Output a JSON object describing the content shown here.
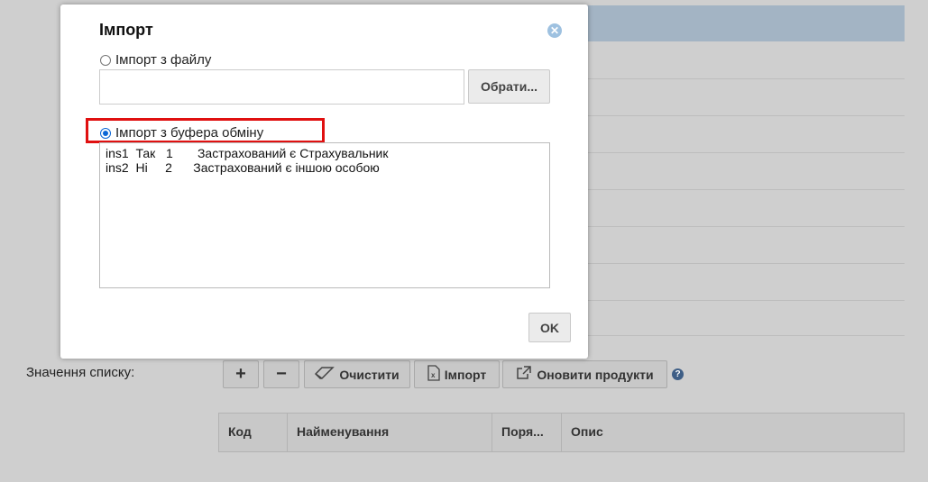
{
  "background": {
    "list_values_label": "Значення списку:",
    "toolbar": {
      "add_icon": "+",
      "remove_icon": "−",
      "clear_label": "Очистити",
      "import_label": "Імпорт",
      "update_products_label": "Оновити продукти",
      "help_icon": "?"
    },
    "grid_columns": [
      "Код",
      "Найменування",
      "Поря...",
      "Опис"
    ]
  },
  "dialog": {
    "title": "Імпорт",
    "close_icon": "✕",
    "option_file_label": "Імпорт з файлу",
    "file_value": "",
    "browse_label": "Обрати...",
    "option_clipboard_label": "Імпорт з буфера обміну",
    "selected_option": "clipboard",
    "clipboard_lines": [
      "ins1  Так   1       Застрахований є Страхувальник",
      "ins2  Ні     2      Застрахований є іншою особою"
    ],
    "ok_label": "OK"
  },
  "colors": {
    "header_bar": "#a3b4c4",
    "highlight_border": "#e01010",
    "radio_selected": "#0a66d6"
  }
}
